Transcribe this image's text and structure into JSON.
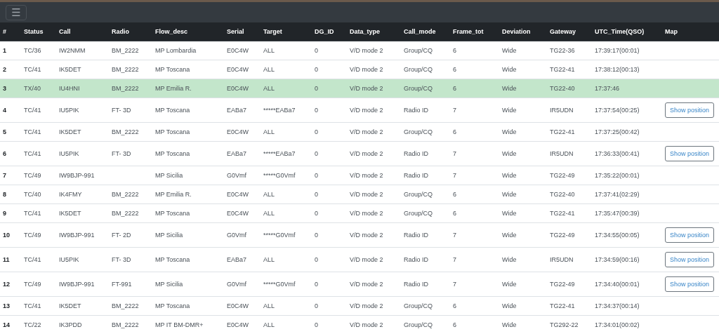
{
  "navbar": {
    "menu_button": "☰"
  },
  "table": {
    "columns": [
      "#",
      "Status",
      "Call",
      "Radio",
      "Flow_desc",
      "Serial",
      "Target",
      "DG_ID",
      "Data_type",
      "Call_mode",
      "Frame_tot",
      "Deviation",
      "Gateway",
      "UTC_Time(QSO)",
      "Map"
    ],
    "rows": [
      {
        "number": "1",
        "status": "TC/36",
        "call": "IW2NMM",
        "radio": "BM_2222",
        "flow_desc": "MP Lombardia",
        "serial": "E0C4W",
        "target": "ALL",
        "dg_id": "0",
        "data_type": "V/D mode 2",
        "call_mode": "Group/CQ",
        "frame_tot": "6",
        "deviation": "Wide",
        "gateway": "TG22-36",
        "utc_time": "17:39:17(00:01)",
        "selected": false
      },
      {
        "number": "2",
        "status": "TC/41",
        "call": "IK5DET",
        "radio": "BM_2222",
        "flow_desc": "MP Toscana",
        "serial": "E0C4W",
        "target": "ALL",
        "dg_id": "0",
        "data_type": "V/D mode 2",
        "call_mode": "Group/CQ",
        "frame_tot": "6",
        "deviation": "Wide",
        "gateway": "TG22-41",
        "utc_time": "17:38:12(00:13)",
        "selected": false
      },
      {
        "number": "3",
        "status": "TX/40",
        "call": "IU4HNI",
        "radio": "BM_2222",
        "flow_desc": "MP Emilia R.",
        "serial": "E0C4W",
        "target": "ALL",
        "dg_id": "0",
        "data_type": "V/D mode 2",
        "call_mode": "Group/CQ",
        "frame_tot": "6",
        "deviation": "Wide",
        "gateway": "TG22-40",
        "utc_time": "17:37:46",
        "selected": true
      },
      {
        "number": "4",
        "status": "TC/41",
        "call": "IU5PIK",
        "radio": "FT- 3D",
        "flow_desc": "MP Toscana",
        "serial": "EABa7",
        "target": "*****EABa7",
        "dg_id": "0",
        "data_type": "V/D mode 2",
        "call_mode": "Radio ID",
        "frame_tot": "7",
        "deviation": "Wide",
        "gateway": "IR5UDN",
        "utc_time": "17:37:54(00:25)",
        "map_button": "Show position",
        "selected": false
      },
      {
        "number": "5",
        "status": "TC/41",
        "call": "IK5DET",
        "radio": "BM_2222",
        "flow_desc": "MP Toscana",
        "serial": "E0C4W",
        "target": "ALL",
        "dg_id": "0",
        "data_type": "V/D mode 2",
        "call_mode": "Group/CQ",
        "frame_tot": "6",
        "deviation": "Wide",
        "gateway": "TG22-41",
        "utc_time": "17:37:25(00:42)",
        "selected": false
      },
      {
        "number": "6",
        "status": "TC/41",
        "call": "IU5PIK",
        "radio": "FT- 3D",
        "flow_desc": "MP Toscana",
        "serial": "EABa7",
        "target": "*****EABa7",
        "dg_id": "0",
        "data_type": "V/D mode 2",
        "call_mode": "Radio ID",
        "frame_tot": "7",
        "deviation": "Wide",
        "gateway": "IR5UDN",
        "utc_time": "17:36:33(00:41)",
        "map_button": "Show position",
        "selected": false
      },
      {
        "number": "7",
        "status": "TC/49",
        "call": "IW9BJP-991",
        "flow_desc": "MP Sicilia",
        "serial": "G0Vmf",
        "target": "*****G0Vmf",
        "dg_id": "0",
        "data_type": "V/D mode 2",
        "call_mode": "Radio ID",
        "frame_tot": "7",
        "deviation": "Wide",
        "gateway": "TG22-49",
        "utc_time": "17:35:22(00:01)",
        "selected": false
      },
      {
        "number": "8",
        "status": "TC/40",
        "call": "IK4FMY",
        "radio": "BM_2222",
        "flow_desc": "MP Emilia R.",
        "serial": "E0C4W",
        "target": "ALL",
        "dg_id": "0",
        "data_type": "V/D mode 2",
        "call_mode": "Group/CQ",
        "frame_tot": "6",
        "deviation": "Wide",
        "gateway": "TG22-40",
        "utc_time": "17:37:41(02:29)",
        "selected": false
      },
      {
        "number": "9",
        "status": "TC/41",
        "call": "IK5DET",
        "radio": "BM_2222",
        "flow_desc": "MP Toscana",
        "serial": "E0C4W",
        "target": "ALL",
        "dg_id": "0",
        "data_type": "V/D mode 2",
        "call_mode": "Group/CQ",
        "frame_tot": "6",
        "deviation": "Wide",
        "gateway": "TG22-41",
        "utc_time": "17:35:47(00:39)",
        "selected": false
      },
      {
        "number": "10",
        "status": "TC/49",
        "call": "IW9BJP-991",
        "radio": "FT- 2D",
        "flow_desc": "MP Sicilia",
        "serial": "G0Vmf",
        "target": "*****G0Vmf",
        "dg_id": "0",
        "data_type": "V/D mode 2",
        "call_mode": "Radio ID",
        "frame_tot": "7",
        "deviation": "Wide",
        "gateway": "TG22-49",
        "utc_time": "17:34:55(00:05)",
        "map_button": "Show position",
        "selected": false
      },
      {
        "number": "11",
        "status": "TC/41",
        "call": "IU5PIK",
        "radio": "FT- 3D",
        "flow_desc": "MP Toscana",
        "serial": "EABa7",
        "target": "ALL",
        "dg_id": "0",
        "data_type": "V/D mode 2",
        "call_mode": "Radio ID",
        "frame_tot": "7",
        "deviation": "Wide",
        "gateway": "IR5UDN",
        "utc_time": "17:34:59(00:16)",
        "map_button": "Show position",
        "selected": false
      },
      {
        "number": "12",
        "status": "TC/49",
        "call": "IW9BJP-991",
        "radio": "FT-991",
        "flow_desc": "MP Sicilia",
        "serial": "G0Vmf",
        "target": "*****G0Vmf",
        "dg_id": "0",
        "data_type": "V/D mode 2",
        "call_mode": "Radio ID",
        "frame_tot": "7",
        "deviation": "Wide",
        "gateway": "TG22-49",
        "utc_time": "17:34:40(00:01)",
        "map_button": "Show position",
        "selected": false
      },
      {
        "number": "13",
        "status": "TC/41",
        "call": "IK5DET",
        "radio": "BM_2222",
        "flow_desc": "MP Toscana",
        "serial": "E0C4W",
        "target": "ALL",
        "dg_id": "0",
        "data_type": "V/D mode 2",
        "call_mode": "Group/CQ",
        "frame_tot": "6",
        "deviation": "Wide",
        "gateway": "TG22-41",
        "utc_time": "17:34:37(00:14)",
        "selected": false
      },
      {
        "number": "14",
        "status": "TC/22",
        "call": "IK3PDD",
        "radio": "BM_2222",
        "flow_desc": "MP IT BM-DMR+",
        "serial": "E0C4W",
        "target": "ALL",
        "dg_id": "0",
        "data_type": "V/D mode 2",
        "call_mode": "Group/CQ",
        "frame_tot": "6",
        "deviation": "Wide",
        "gateway": "TG292-22",
        "utc_time": "17:34:01(00:02)",
        "selected": false
      }
    ]
  }
}
